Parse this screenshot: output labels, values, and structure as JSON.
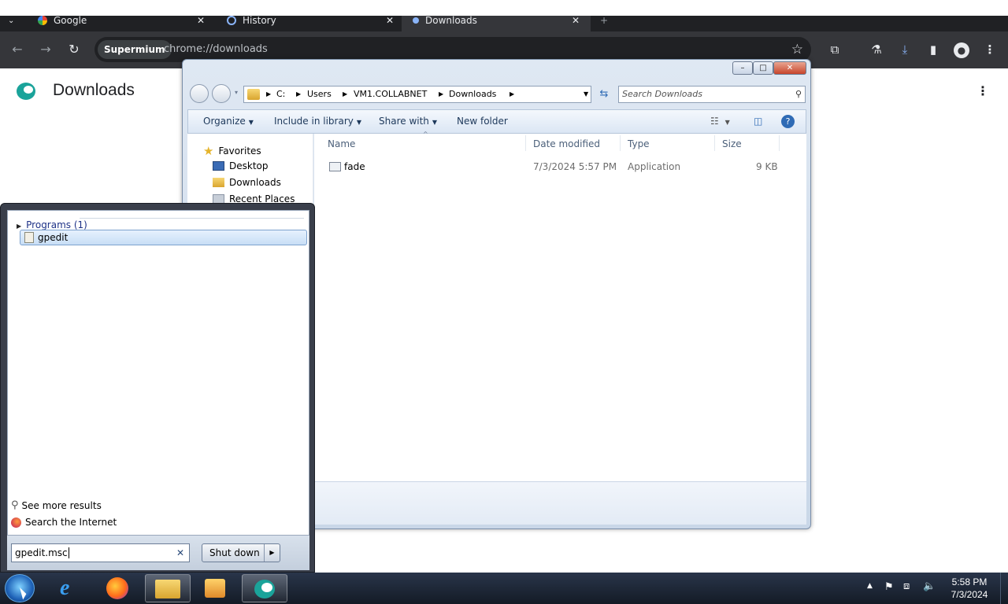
{
  "browser": {
    "tabs": [
      {
        "title": "Google"
      },
      {
        "title": "History"
      },
      {
        "title": "Downloads"
      }
    ],
    "chip_label": "Supermium",
    "url": "chrome://downloads",
    "page_title": "Downloads",
    "icons": [
      "back-icon",
      "forward-icon",
      "reload-icon",
      "star-icon",
      "extensions-icon",
      "labs-icon",
      "download-icon",
      "side-panel-icon",
      "profile-icon",
      "menu-icon"
    ]
  },
  "explorer": {
    "window_controls": [
      "–",
      "□",
      "✕"
    ],
    "breadcrumbs": [
      "C:",
      "Users",
      "VM1.COLLABNET",
      "Downloads"
    ],
    "search_placeholder": "Search Downloads",
    "commands": {
      "organize": "Organize",
      "include_in_library": "Include in library",
      "share_with": "Share with",
      "new_folder": "New folder"
    },
    "nav": {
      "favorites": "Favorites",
      "items": [
        "Desktop",
        "Downloads",
        "Recent Places"
      ]
    },
    "columns": [
      "Name",
      "Date modified",
      "Type",
      "Size"
    ],
    "files": [
      {
        "name": "fade",
        "date": "7/3/2024 5:57 PM",
        "type": "Application",
        "size": "9 KB"
      }
    ]
  },
  "start_menu": {
    "group_label": "Programs (1)",
    "results": [
      "gpedit"
    ],
    "see_more": "See more results",
    "search_internet": "Search the Internet",
    "search_value": "gpedit.msc",
    "shutdown_label": "Shut down"
  },
  "taskbar": {
    "apps": [
      "start-orb-icon",
      "internet-explorer-icon",
      "firefox-icon",
      "file-explorer-icon",
      "media-player-icon",
      "supermium-icon"
    ],
    "clock_time": "5:58 PM",
    "clock_date": "7/3/2024"
  }
}
